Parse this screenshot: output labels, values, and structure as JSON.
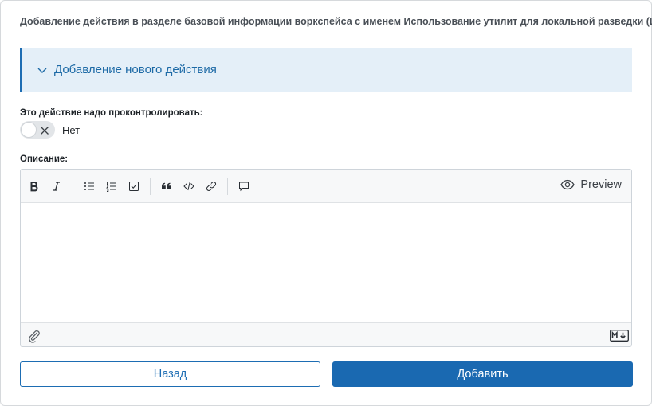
{
  "header": {
    "title": "Добавление действия в разделе базовой информации воркспейса с именем Использование утилит для локальной разведки (Linux)"
  },
  "accordion": {
    "label": "Добавление нового действия",
    "icon": "chevron-down-icon"
  },
  "control": {
    "label": "Это действие надо проконтролировать:",
    "toggle_state": "Нет",
    "toggle_on": false
  },
  "description": {
    "label": "Описание:",
    "toolbar": {
      "buttons": [
        "bold-icon",
        "italic-icon",
        "bullet-list-icon",
        "numbered-list-icon",
        "task-list-icon",
        "quote-icon",
        "code-icon",
        "link-icon",
        "comment-icon"
      ],
      "preview_label": "Preview"
    },
    "value": "",
    "footer": {
      "attach_icon": "paperclip-icon",
      "markdown_icon": "markdown-icon"
    }
  },
  "actions": {
    "back_label": "Назад",
    "add_label": "Добавить"
  },
  "colors": {
    "accent": "#1a69b1",
    "accordion_bg": "#e4eff8"
  }
}
